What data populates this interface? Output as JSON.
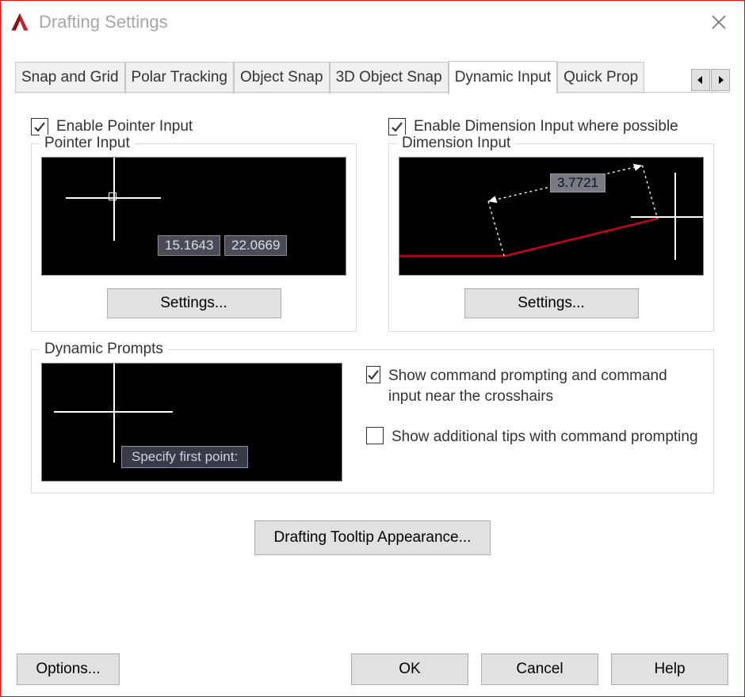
{
  "title": "Drafting Settings",
  "tabs": {
    "snap_grid": "Snap and Grid",
    "polar": "Polar Tracking",
    "osnap": "Object Snap",
    "osnap3d": "3D Object Snap",
    "dyninput": "Dynamic Input",
    "quickprops": "Quick Prop"
  },
  "enable_pointer_label": "Enable Pointer Input",
  "enable_dimension_label": "Enable Dimension Input where possible",
  "pointer_group": "Pointer Input",
  "dimension_group": "Dimension Input",
  "prompts_group": "Dynamic Prompts",
  "settings_btn": "Settings...",
  "pointer_coord_x": "15.1643",
  "pointer_coord_y": "22.0669",
  "dimension_value": "3.7721",
  "prompt_text": "Specify first point:",
  "show_prompting_label": "Show command prompting and command input near the crosshairs",
  "show_tips_label": "Show additional tips with command prompting",
  "tooltip_appearance_btn": "Drafting Tooltip Appearance...",
  "options_btn": "Options...",
  "ok_btn": "OK",
  "cancel_btn": "Cancel",
  "help_btn": "Help"
}
